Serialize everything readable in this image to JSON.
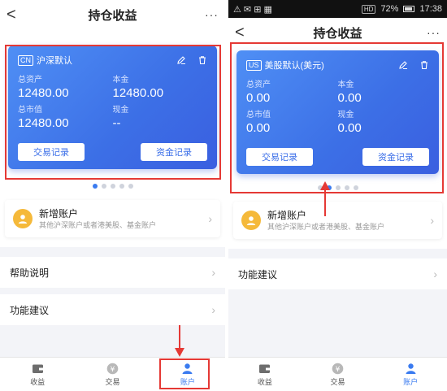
{
  "left": {
    "nav": {
      "back": "<",
      "title": "持仓收益",
      "more": "···"
    },
    "card": {
      "market_tag": "CN",
      "account_name": "沪深默认",
      "fields": [
        {
          "label": "总资产",
          "value": "12480.00"
        },
        {
          "label": "本金",
          "value": "12480.00"
        },
        {
          "label": "总市值",
          "value": "12480.00"
        },
        {
          "label": "现金",
          "value": "--"
        }
      ],
      "btn_trade": "交易记录",
      "btn_funds": "资金记录"
    },
    "dots": {
      "count": 5,
      "active": 0
    },
    "add_account": {
      "title": "新增账户",
      "subtitle": "其他沪深账户或者港美股、基金账户"
    },
    "list": [
      "帮助说明",
      "功能建议"
    ],
    "tabs": [
      "收益",
      "交易",
      "账户"
    ]
  },
  "right": {
    "statusbar": {
      "left": "⚠ ✉ ⊞ ▦",
      "network": "HD",
      "battery": "72%",
      "time": "17:38"
    },
    "nav": {
      "back": "<",
      "title": "持仓收益",
      "more": "···"
    },
    "card": {
      "market_tag": "US",
      "account_name": "美股默认(美元)",
      "fields": [
        {
          "label": "总资产",
          "value": "0.00"
        },
        {
          "label": "本金",
          "value": "0.00"
        },
        {
          "label": "总市值",
          "value": "0.00"
        },
        {
          "label": "现金",
          "value": "0.00"
        }
      ],
      "btn_trade": "交易记录",
      "btn_funds": "资金记录"
    },
    "dots": {
      "count": 5,
      "active": 1
    },
    "add_account": {
      "title": "新增账户",
      "subtitle": "其他沪深账户或者港美股、基金账户"
    },
    "list": [
      "功能建议"
    ],
    "tabs": [
      "收益",
      "交易",
      "账户"
    ]
  },
  "colors": {
    "accent": "#3a7bf0",
    "card": "#4a7ff0",
    "highlight": "#e53935",
    "avatar": "#f5b93a"
  },
  "icons": [
    "edit-icon",
    "trash-icon",
    "user-icon",
    "wallet-icon",
    "yen-coin-icon",
    "account-icon"
  ]
}
